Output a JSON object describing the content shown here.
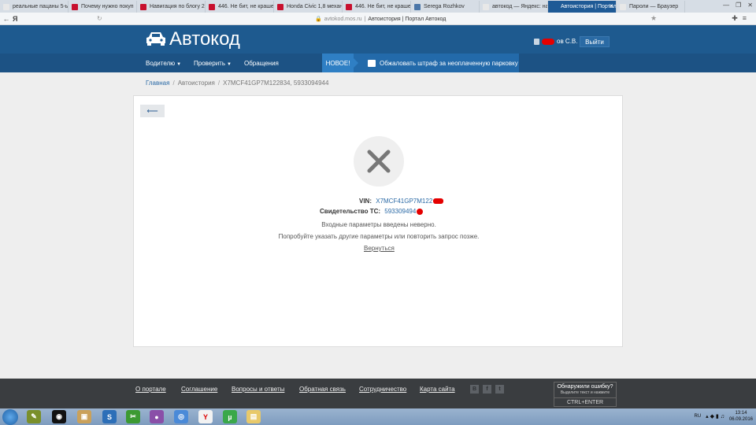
{
  "browser": {
    "tabs": [
      {
        "label": "реальные пацаны 5-ы",
        "fav_color": "#e8e8e8",
        "active": false
      },
      {
        "label": "Почему нужно покуп",
        "fav_color": "#c8102e",
        "active": false
      },
      {
        "label": "Навигация по блогу 2",
        "fav_color": "#c8102e",
        "active": false
      },
      {
        "label": "446. Не бит, не краше",
        "fav_color": "#c8102e",
        "active": false
      },
      {
        "label": "Honda Civic 1,8 механ",
        "fav_color": "#c8102e",
        "active": false
      },
      {
        "label": "446. Не бит, не краше",
        "fav_color": "#c8102e",
        "active": false
      },
      {
        "label": "Serega Rozhkov",
        "fav_color": "#4a76a8",
        "active": false
      },
      {
        "label": "автокод — Яндекс: на",
        "fav_color": "#e8e8e8",
        "active": false
      },
      {
        "label": "Автоистория | Портал",
        "fav_color": "#1e5a96",
        "active": true
      },
      {
        "label": "Пароли — Браузер",
        "fav_color": "#e8e8e8",
        "active": false
      }
    ],
    "url_host": "avtokod.mos.ru",
    "page_title": "Автоистория | Портал Автокод",
    "yandex_letter": "Я"
  },
  "header": {
    "logo_text": "Автокод",
    "user_name_suffix": "ов С.В.",
    "logout_label": "Выйти"
  },
  "nav": {
    "items": [
      "Водителю",
      "Проверить",
      "Обращения"
    ],
    "promo_badge": "НОВОЕ!",
    "promo_text": "Обжаловать штраф за неоплаченную парковку"
  },
  "breadcrumb": {
    "home": "Главная",
    "section": "Автоистория",
    "current": "X7MCF41GP7M122834, 5933094944"
  },
  "result": {
    "vin_label": "VIN:",
    "vin_value": "X7MCF41GP7M122",
    "cert_label": "Свидетельство ТС:",
    "cert_value": "593309494",
    "error_line1": "Входные параметры введены неверно.",
    "error_line2": "Попробуйте указать другие параметры или повторить запрос позже.",
    "retry_label": "Вернуться"
  },
  "footer": {
    "links": [
      "О портале",
      "Соглашение",
      "Вопросы и ответы",
      "Обратная связь",
      "Сотрудничество",
      "Карта сайта"
    ],
    "social": [
      "В",
      "f",
      "t"
    ],
    "report_title": "Обнаружили ошибку?",
    "report_hint": "Выделите текст и нажмите",
    "report_keys": "CTRL+ENTER"
  },
  "taskbar": {
    "lang": "RU",
    "time": "13:14",
    "date": "06.09.2016"
  }
}
